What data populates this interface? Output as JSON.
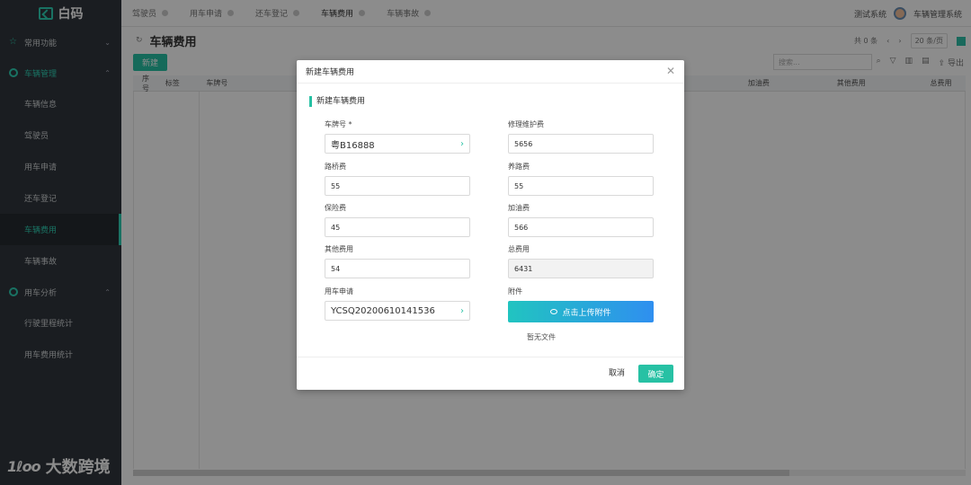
{
  "app": {
    "brand": "白码"
  },
  "sidebar": {
    "groups": [
      {
        "label": "常用功能"
      },
      {
        "label": "车辆管理"
      },
      {
        "label": "用车分析"
      }
    ],
    "items": [
      {
        "label": "车辆信息"
      },
      {
        "label": "驾驶员"
      },
      {
        "label": "用车申请"
      },
      {
        "label": "还车登记"
      },
      {
        "label": "车辆费用"
      },
      {
        "label": "车辆事故"
      },
      {
        "label": "行驶里程统计"
      },
      {
        "label": "用车费用统计"
      }
    ]
  },
  "tabs": [
    {
      "label": "驾驶员"
    },
    {
      "label": "用车申请"
    },
    {
      "label": "还车登记"
    },
    {
      "label": "车辆费用"
    },
    {
      "label": "车辆事故"
    }
  ],
  "header": {
    "system_test": "测试系统",
    "system_name": "车辆管理系统"
  },
  "page": {
    "title": "车辆费用",
    "total": "共 0 条",
    "page_size": "20 条/页",
    "new_button": "新建",
    "search_placeholder": "搜索...",
    "export": "导出",
    "columns": [
      "序号",
      "标签",
      "车牌号",
      "加油费",
      "其他费用",
      "总费用"
    ]
  },
  "dialog": {
    "title": "新建车辆费用",
    "section": "新建车辆费用",
    "fields": {
      "plate": {
        "label": "车牌号 *",
        "value": "粤B16888"
      },
      "maintenance": {
        "label": "修理维护费",
        "value": "5656"
      },
      "toll": {
        "label": "路桥费",
        "value": "55"
      },
      "road": {
        "label": "养路费",
        "value": "55"
      },
      "insurance": {
        "label": "保险费",
        "value": "45"
      },
      "fuel": {
        "label": "加油费",
        "value": "566"
      },
      "other": {
        "label": "其他费用",
        "value": "54"
      },
      "total": {
        "label": "总费用",
        "value": "6431"
      },
      "request": {
        "label": "用车申请",
        "value": "YCSQ20200610141536"
      },
      "attachment": {
        "label": "附件"
      }
    },
    "upload_button": "点击上传附件",
    "no_file": "暂无文件",
    "cancel": "取消",
    "confirm": "确定"
  },
  "watermark": {
    "logo": "1ℓoo",
    "text": "大数跨境"
  },
  "colors": {
    "accent": "#27c1a4",
    "sidebar": "#30363c"
  }
}
